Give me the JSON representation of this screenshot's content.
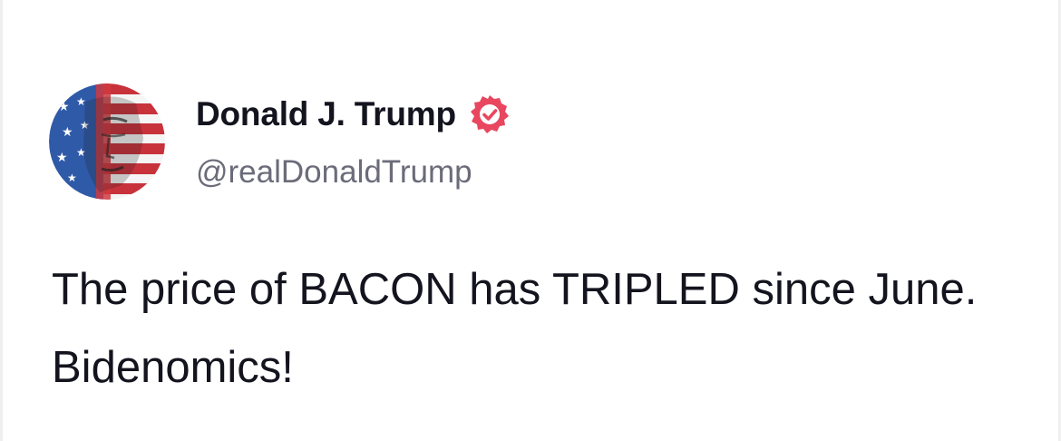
{
  "post": {
    "author": {
      "display_name": "Donald J. Trump",
      "handle": "@realDonaldTrump",
      "verified": true
    },
    "text": "The price of BACON has TRIPLED since June. Bidenomics!"
  },
  "colors": {
    "badge": "#e8475f",
    "name_text": "#14141f",
    "handle_text": "#6b6b7a"
  },
  "icons": {
    "avatar": "flag-portrait-avatar",
    "badge": "verified-check-icon"
  }
}
